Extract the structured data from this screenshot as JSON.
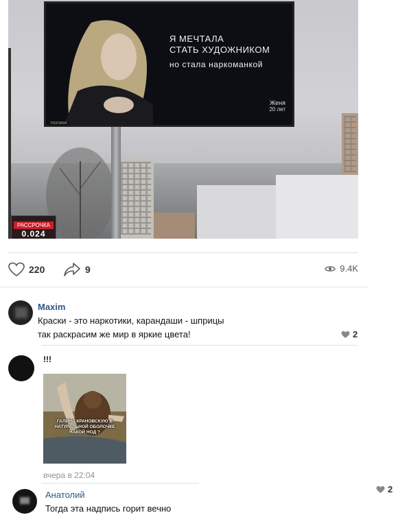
{
  "post": {
    "billboard": {
      "line1": "Я МЕЧТАЛА",
      "line2": "СТАТЬ ХУДОЖНИКОМ",
      "line3": "но стала наркоманкой",
      "name": "Женя",
      "age": "20 лет",
      "small": "РЕКЛАМА"
    },
    "ad_sign": {
      "label": "РАССРОЧКА",
      "value": "0.024"
    }
  },
  "actions": {
    "likes": "220",
    "shares": "9",
    "views": "9.4K"
  },
  "comments": [
    {
      "author": "Maxim",
      "line1": "Краски - это наркотики, карандаши - шприцы",
      "line2": "так раскрасим же мир в яркие цвета!",
      "likes": "2"
    },
    {
      "text": "!!!",
      "image_caption": "ГАЛИНА КРАНОВСКУЮ В НАТУРАЛЬНОЙ ОБОЛОЧКЕ НАКОЙ НОД ?",
      "timestamp": "вчера в 22:04"
    },
    {
      "author": "Анатолий",
      "text": "Тогда эта надпись горит вечно",
      "likes": "2"
    }
  ],
  "colors": {
    "author": "#2a5885",
    "muted": "#939393",
    "divider": "#dcdfe3"
  }
}
